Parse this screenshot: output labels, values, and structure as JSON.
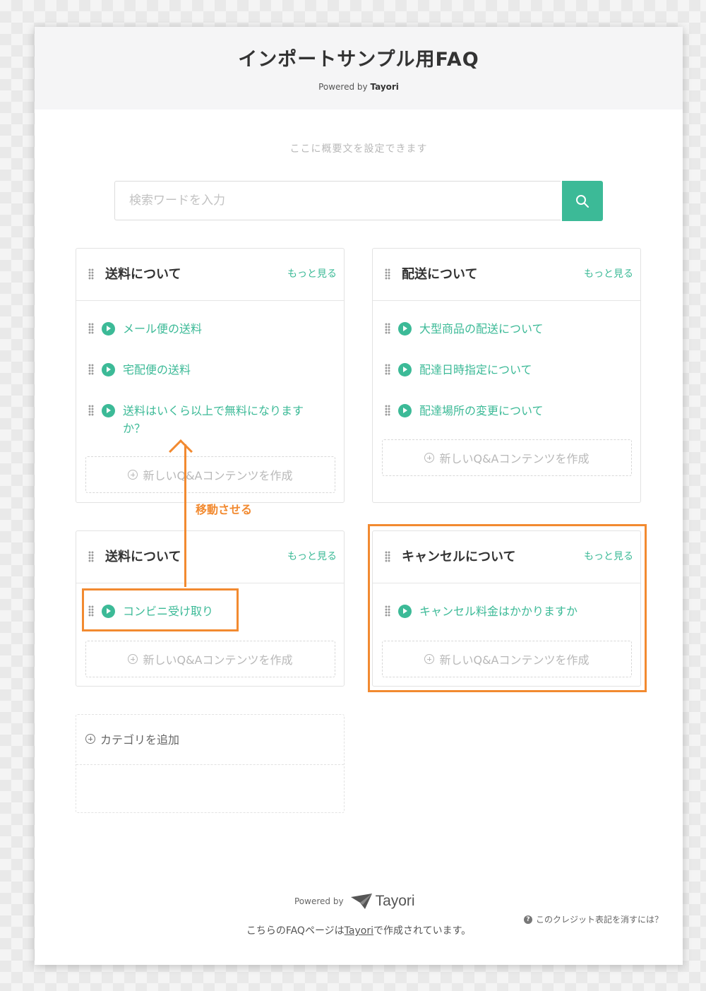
{
  "header": {
    "title": "インポートサンプル用FAQ",
    "powered_prefix": "Powered by",
    "powered_brand": "Tayori"
  },
  "summary": "ここに概要文を設定できます",
  "search": {
    "placeholder": "検索ワードを入力",
    "value": "",
    "button_icon": "search-icon"
  },
  "categories": [
    {
      "title": "送料について",
      "more": "もっと見る",
      "items": [
        "メール便の送料",
        "宅配便の送料",
        "送料はいくら以上で無料になります",
        "か？"
      ],
      "new_button": "新しいQ&Aコンテンツを作成"
    },
    {
      "title": "配送について",
      "more": "もっと見る",
      "items": [
        "大型商品の配送について",
        "配達日時指定について",
        "配達場所の変更について"
      ],
      "new_button": "新しいQ&Aコンテンツを作成"
    },
    {
      "title": "送料について",
      "more": "もっと見る",
      "items": [
        "コンビニ受け取り"
      ],
      "new_button": "新しいQ&Aコンテンツを作成"
    },
    {
      "title": "キャンセルについて",
      "more": "もっと見る",
      "items": [
        "キャンセル料金はかかりますか"
      ],
      "new_button": "新しいQ&Aコンテンツを作成"
    }
  ],
  "add_category": "カテゴリを追加",
  "annotation": {
    "label": "移動させる",
    "color": "#f28a30"
  },
  "footer": {
    "powered_by": "Powered by",
    "brand": "Tayori",
    "credit_prefix": "こちらのFAQページは",
    "credit_link": "Tayori",
    "credit_suffix": "で作成されています。",
    "credit_help": "このクレジット表記を消すには？"
  },
  "colors": {
    "accent": "#3cba97",
    "annotation": "#f28a30"
  }
}
